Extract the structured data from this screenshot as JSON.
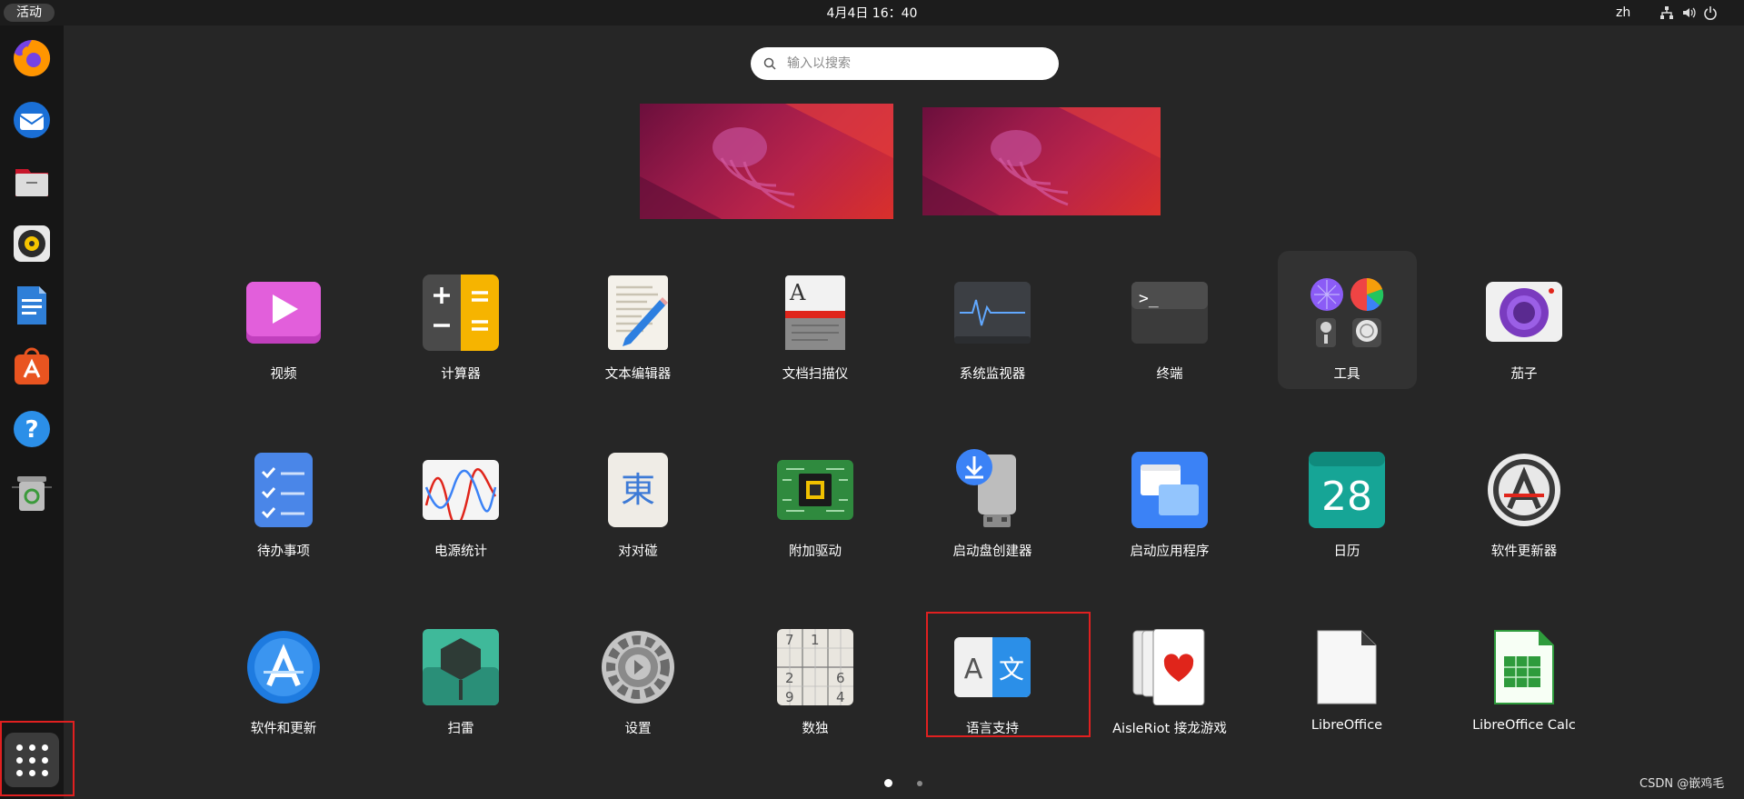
{
  "topbar": {
    "activities": "活动",
    "clock": "4月4日  16：40",
    "language": "zh",
    "tray_icons": [
      "network-icon",
      "volume-icon",
      "power-icon"
    ]
  },
  "dock": {
    "items": [
      "firefox-icon",
      "thunderbird-icon",
      "files-icon",
      "rhythmbox-icon",
      "libreoffice-writer-icon",
      "app-center-icon",
      "help-icon",
      "trash-icon"
    ],
    "show_apps_icon": "app-grid-icon"
  },
  "search": {
    "placeholder": "输入以搜索"
  },
  "apps": {
    "row1": [
      "视频",
      "计算器",
      "文本编辑器",
      "文档扫描仪",
      "系统监视器",
      "终端",
      "工具",
      "茄子"
    ],
    "row2": [
      "待办事项",
      "电源统计",
      "对对碰",
      "附加驱动",
      "启动盘创建器",
      "启动应用程序",
      "日历",
      "软件更新器"
    ],
    "row3": [
      "软件和更新",
      "扫雷",
      "设置",
      "数独",
      "语言支持",
      "AisleRiot 接龙游戏",
      "LibreOffice",
      "LibreOffice Calc"
    ]
  },
  "icon_text": {
    "calendar_day": "28",
    "mahjongg_char": "東",
    "terminal_prompt": ">_",
    "lang_left": "A",
    "lang_right": "文",
    "scanner_letter": "A",
    "sudoku": [
      "7",
      "1",
      "",
      "",
      "",
      "",
      "2",
      "",
      "6",
      "9",
      "",
      "4"
    ]
  },
  "pager": {
    "pages": 2,
    "current": 1
  },
  "watermark": "CSDN @嵌鸡毛",
  "colors": {
    "highlight_box": "#e02020",
    "background": "#262626",
    "dock": "#161616"
  }
}
